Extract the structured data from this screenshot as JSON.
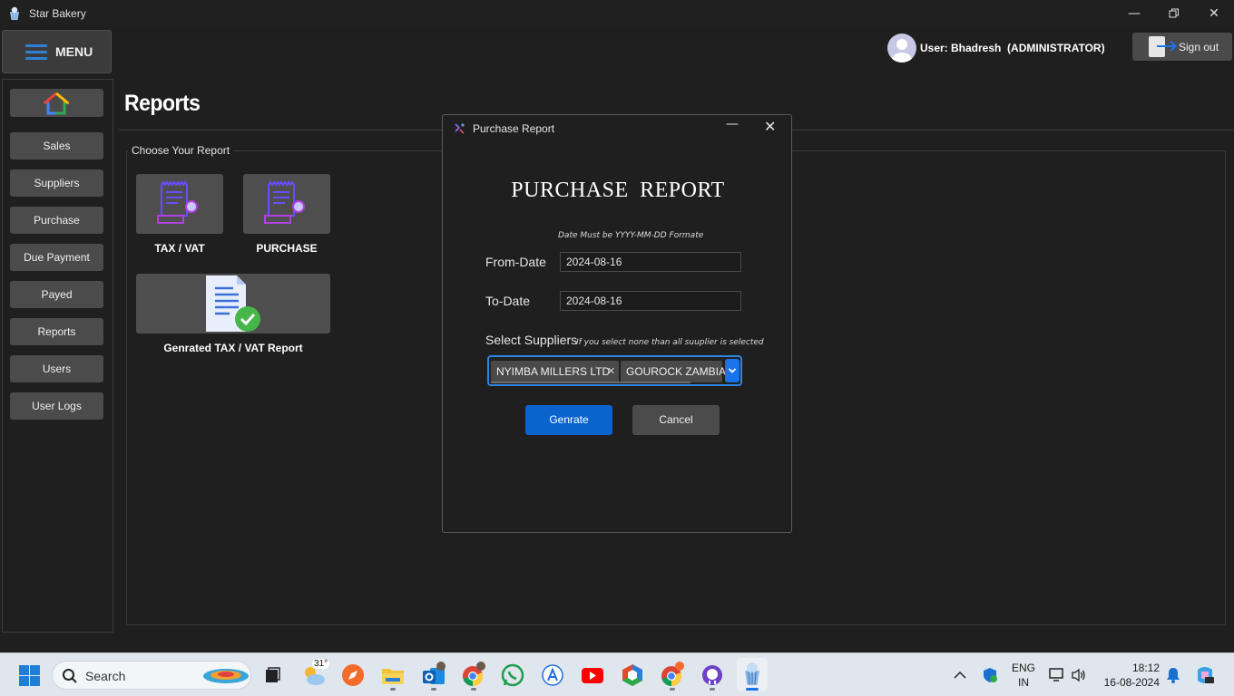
{
  "window": {
    "title": "Star Bakery",
    "controls": [
      "minimize",
      "restore",
      "close"
    ]
  },
  "header": {
    "menu_label": "MENU",
    "user_label": "User: Bhadresh  (ADMINISTRATOR)",
    "signout_label": "Sign out"
  },
  "sidebar": {
    "items": [
      {
        "label": "Sales"
      },
      {
        "label": "Suppliers"
      },
      {
        "label": "Purchase"
      },
      {
        "label": "Due Payment"
      },
      {
        "label": "Payed"
      },
      {
        "label": "Reports"
      },
      {
        "label": "Users"
      },
      {
        "label": "User Logs"
      }
    ]
  },
  "main": {
    "title": "Reports",
    "panel_legend": "Choose Your Report",
    "tiles": [
      {
        "label": "TAX / VAT",
        "icon": "receipt-icon"
      },
      {
        "label": "PURCHASE",
        "icon": "receipt-icon"
      },
      {
        "label": "Genrated TAX / VAT Report",
        "icon": "document-check-icon"
      }
    ]
  },
  "dialog": {
    "title": "Purchase Report",
    "heading": "PURCHASE  REPORT",
    "date_hint": "Date Must be YYYY-MM-DD Formate",
    "from_label": "From-Date",
    "from_value": "2024-08-16",
    "to_label": "To-Date",
    "to_value": "2024-08-16",
    "suppliers_label": "Select Suppliers",
    "suppliers_hint": "If you select none than all suuplier is selected",
    "selected_suppliers": [
      "NYIMBA MILLERS LTD",
      "GOUROCK ZAMBIA"
    ],
    "generate_label": "Genrate",
    "cancel_label": "Cancel"
  },
  "taskbar": {
    "search_placeholder": "Search",
    "weather_temp": "31°",
    "language": "ENG",
    "region": "IN",
    "time": "18:12",
    "date": "16-08-2024",
    "pinned_apps": [
      "task-view",
      "weather",
      "compass",
      "file-explorer",
      "outlook",
      "chrome",
      "whatsapp",
      "app-store",
      "youtube",
      "office",
      "chrome-profile",
      "github",
      "star-bakery"
    ]
  },
  "colors": {
    "accent": "#0b63ce",
    "background": "#1f1f1f",
    "button": "#4b4b4b",
    "focus": "#2f84e0"
  }
}
